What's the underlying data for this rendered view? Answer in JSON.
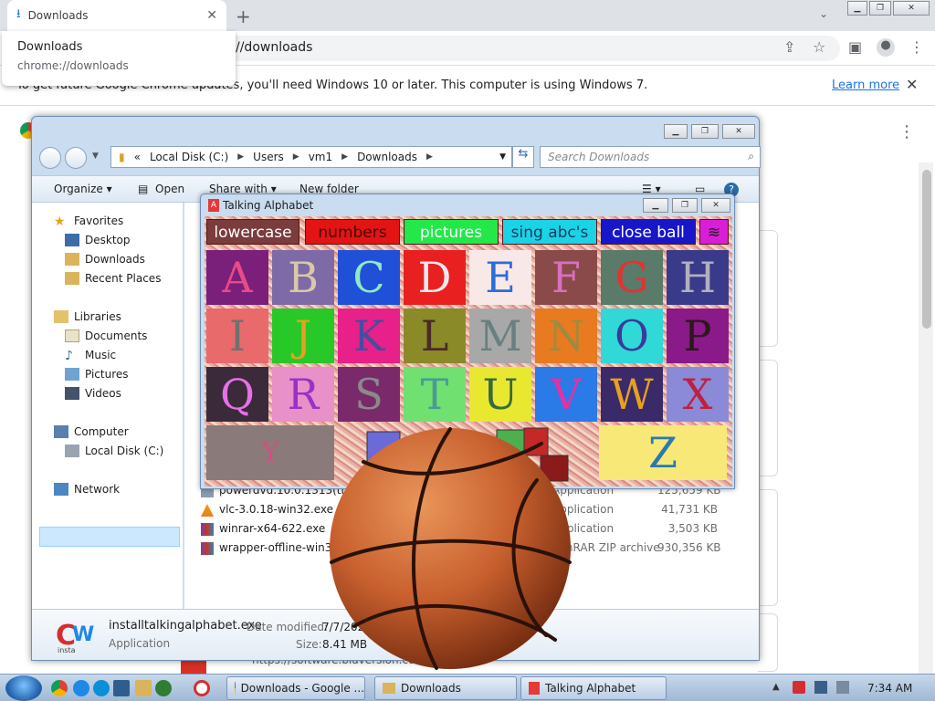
{
  "chrome": {
    "tab_title": "Downloads",
    "tooltip_title": "Downloads",
    "tooltip_url": "chrome://downloads",
    "omnibox_text": "//downloads",
    "infobar_text": "To get future Google Chrome updates, you'll need Windows 10 or later. This computer is using Windows 7.",
    "learn_more": "Learn more"
  },
  "explorer": {
    "breadcrumb": [
      "Local Disk (C:)",
      "Users",
      "vm1",
      "Downloads"
    ],
    "search_placeholder": "Search Downloads",
    "commands": {
      "organize": "Organize ▾",
      "open": "Open",
      "share": "Share with ▾",
      "new_folder": "New folder"
    },
    "nav": {
      "favorites": "Favorites",
      "desktop": "Desktop",
      "downloads": "Downloads",
      "recent": "Recent Places",
      "libraries": "Libraries",
      "documents": "Documents",
      "music": "Music",
      "pictures": "Pictures",
      "videos": "Videos",
      "computer": "Computer",
      "local_disk": "Local Disk (C:)",
      "network": "Network"
    },
    "files": [
      {
        "name": "powerdvd.10.0.1313(trial).",
        "type": "Application",
        "size": "125,659 KB"
      },
      {
        "name": "vlc-3.0.18-win32.exe",
        "type": "Application",
        "size": "41,731 KB"
      },
      {
        "name": "winrar-x64-622.exe",
        "type": "Application",
        "size": "3,503 KB"
      },
      {
        "name": "wrapper-offline-win32",
        "type": "WinRAR ZIP archive",
        "size": "930,356 KB"
      }
    ],
    "details": {
      "name": "installtalkingalphabet.exe",
      "kind": "Application",
      "modified_label": "Date modified:",
      "modified_value": "7/7/2023 7:32 AM",
      "size_label": "Size:",
      "size_value": "8.41 MB"
    }
  },
  "talking_alphabet": {
    "title": "Talking Alphabet",
    "buttons": [
      "lowercase",
      "numbers",
      "pictures",
      "sing abc's",
      "close ball"
    ],
    "letters": [
      "A",
      "B",
      "C",
      "D",
      "E",
      "F",
      "G",
      "H",
      "I",
      "J",
      "K",
      "L",
      "M",
      "N",
      "O",
      "P",
      "Q",
      "R",
      "S",
      "T",
      "U",
      "V",
      "W",
      "X",
      "Y",
      "Z"
    ]
  },
  "taskbar": {
    "apps": [
      "Downloads - Google ...",
      "Downloads",
      "Talking Alphabet"
    ],
    "clock": "7:34 AM"
  }
}
